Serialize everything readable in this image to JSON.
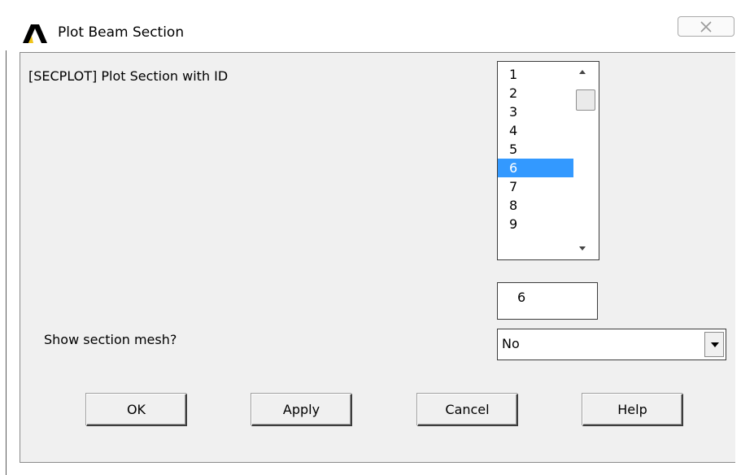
{
  "window": {
    "title": "Plot Beam Section",
    "close_icon": "close-icon"
  },
  "secplot": {
    "label": "[SECPLOT] Plot Section with ID",
    "list_items": [
      "1",
      "2",
      "3",
      "4",
      "5",
      "6",
      "7",
      "8",
      "9"
    ],
    "selected": "6",
    "id_value": "6"
  },
  "mesh": {
    "label": "Show section mesh?",
    "value": "No"
  },
  "buttons": {
    "ok": "OK",
    "apply": "Apply",
    "cancel": "Cancel",
    "help": "Help"
  },
  "colors": {
    "selection": "#3399ff",
    "dialog_bg": "#f0f0f0"
  }
}
